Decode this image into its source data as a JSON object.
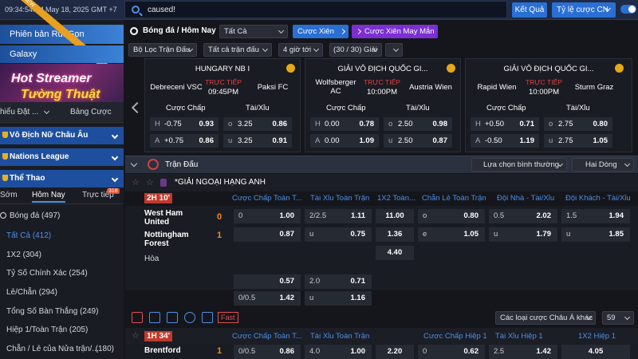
{
  "topbar": {
    "time": "09:34:54PM May 18, 2025 GMT +7",
    "search_value": "caused!",
    "result_button": "Kết Quả",
    "odds_dropdown": "Tỷ lệ cược CN"
  },
  "sidebar": {
    "promo1": "Phiên bản Rút Gọn",
    "promo1_badge": "NEW",
    "promo2": "Galaxy",
    "promo3_line1": "Hot Streamer",
    "promo3_line2": "Tường Thuật",
    "tab_left": "hiểu Đặt ...",
    "tab_right": "Bảng Cược",
    "sections": [
      "Vô Địch Nữ Châu Âu",
      "Nations League",
      "Thể Thao"
    ],
    "subtabs": [
      "Sớm",
      "Hôm Nay",
      "Trực tiếp"
    ],
    "subtab_badge": "318",
    "menu": [
      {
        "label": "Bóng đá",
        "count": "(497)"
      },
      {
        "label": "Tất Cả (412)",
        "count": ""
      },
      {
        "label": "1X2 (304)",
        "count": ""
      },
      {
        "label": "Tỷ Số Chính Xác (254)",
        "count": ""
      },
      {
        "label": "Lẻ/Chẵn (294)",
        "count": ""
      },
      {
        "label": "Tổng Số Bàn Thắng (249)",
        "count": ""
      },
      {
        "label": "Hiệp 1/Toàn Trận (205)",
        "count": ""
      },
      {
        "label": "Chẵn / Lẻ của Nửa trận/...",
        "count": "(180)"
      }
    ]
  },
  "main": {
    "title": "Bóng đá / Hôm Nay",
    "filter_all": "Tất Cả",
    "cuoc_xien": "Cược Xiên",
    "cuoc_xien_may_man": "Cược Xiên May Mắn",
    "filter_league": "Bộ Lọc Trận Đấu",
    "filter_matches": "Tất cả trận đấu",
    "filter_time": "4 giờ tới",
    "filter_count": "(30 / 30) Giải",
    "cards": [
      {
        "league": "HUNGARY NB I",
        "home": "Debreceni VSC",
        "away": "Paksi FC",
        "live": "TRỰC TIẾP",
        "time": "09:45PM",
        "rows": [
          [
            "H",
            "-0.75",
            "0.93",
            "o",
            "3.25",
            "0.86"
          ],
          [
            "A",
            "+0.75",
            "0.86",
            "u",
            "3.25",
            "0.91"
          ]
        ]
      },
      {
        "league": "GIẢI VÔ ĐỊCH QUỐC GI...",
        "home": "Wolfsberger AC",
        "away": "Austria Wien",
        "live": "TRỰC TIẾP",
        "time": "10:00PM",
        "rows": [
          [
            "H",
            "0.00",
            "0.78",
            "o",
            "2.50",
            "0.98"
          ],
          [
            "A",
            "0.00",
            "1.09",
            "u",
            "2.50",
            "0.87"
          ]
        ]
      },
      {
        "league": "GIẢI VÔ ĐỊCH QUỐC GI...",
        "home": "Rapid Wien",
        "away": "Sturm Graz",
        "live": "TRỰC TIẾP",
        "time": "10:00PM",
        "rows": [
          [
            "H",
            "+0.50",
            "0.71",
            "o",
            "2.75",
            "0.80"
          ],
          [
            "A",
            "-0.50",
            "1.19",
            "u",
            "2.75",
            "1.05"
          ]
        ]
      }
    ],
    "market_labels": [
      "Cược Chấp",
      "Tài/Xỉu"
    ],
    "match_bar": "Trận Đấu",
    "select_normal": "Lựa chọn bình thường",
    "select_rows": "Hai Dòng",
    "league_name": "*GIẢI NGOẠI HẠNG ANH",
    "match1": {
      "time": "2H 10'",
      "home": "West Ham United",
      "away": "Nottingham Forest",
      "draw": "Hòa",
      "home_score": "0",
      "away_score": "1",
      "headers": [
        "Cược Chấp Toàn T...",
        "Tài Xỉu Toàn Trận",
        "1X2 Toàn...",
        "Chẵn Lẻ Toàn Trận",
        "Đội Nhà - Tài/Xỉu",
        "Đội Khách - Tài/Xỉu"
      ],
      "row1": [
        "0",
        "1.00",
        "2/2.5",
        "1.11",
        "11.00",
        "o",
        "0.80",
        "0.5",
        "2.02",
        "1.5",
        "1.94"
      ],
      "row2": [
        "",
        "0.87",
        "u",
        "0.75",
        "1.36",
        "e",
        "1.05",
        "u",
        "1.79",
        "u",
        "1.85"
      ],
      "row3": "4.40",
      "row4": [
        "",
        "0.57",
        "2.0",
        "0.71"
      ],
      "row5": [
        "0/0.5",
        "1.42",
        "u",
        "1.16"
      ]
    },
    "fast_label": "Fast",
    "asian_select": "Các loại cược Châu Á khác",
    "count_select": "59",
    "match2": {
      "time": "1H 34'",
      "home": "Brentford",
      "score": "1",
      "headers": [
        "Cược Chấp Toàn T...",
        "Tài Xỉu Toàn Trận",
        "Cược Chấp Hiệp 1",
        "Tài Xỉu Hiệp 1",
        "1X2 Hiệp 1"
      ],
      "row1": [
        "0/0.5",
        "0.86",
        "4.0",
        "1.00",
        "2.20",
        "0",
        "0.62",
        "2.5",
        "1.42",
        "4.05"
      ]
    }
  }
}
